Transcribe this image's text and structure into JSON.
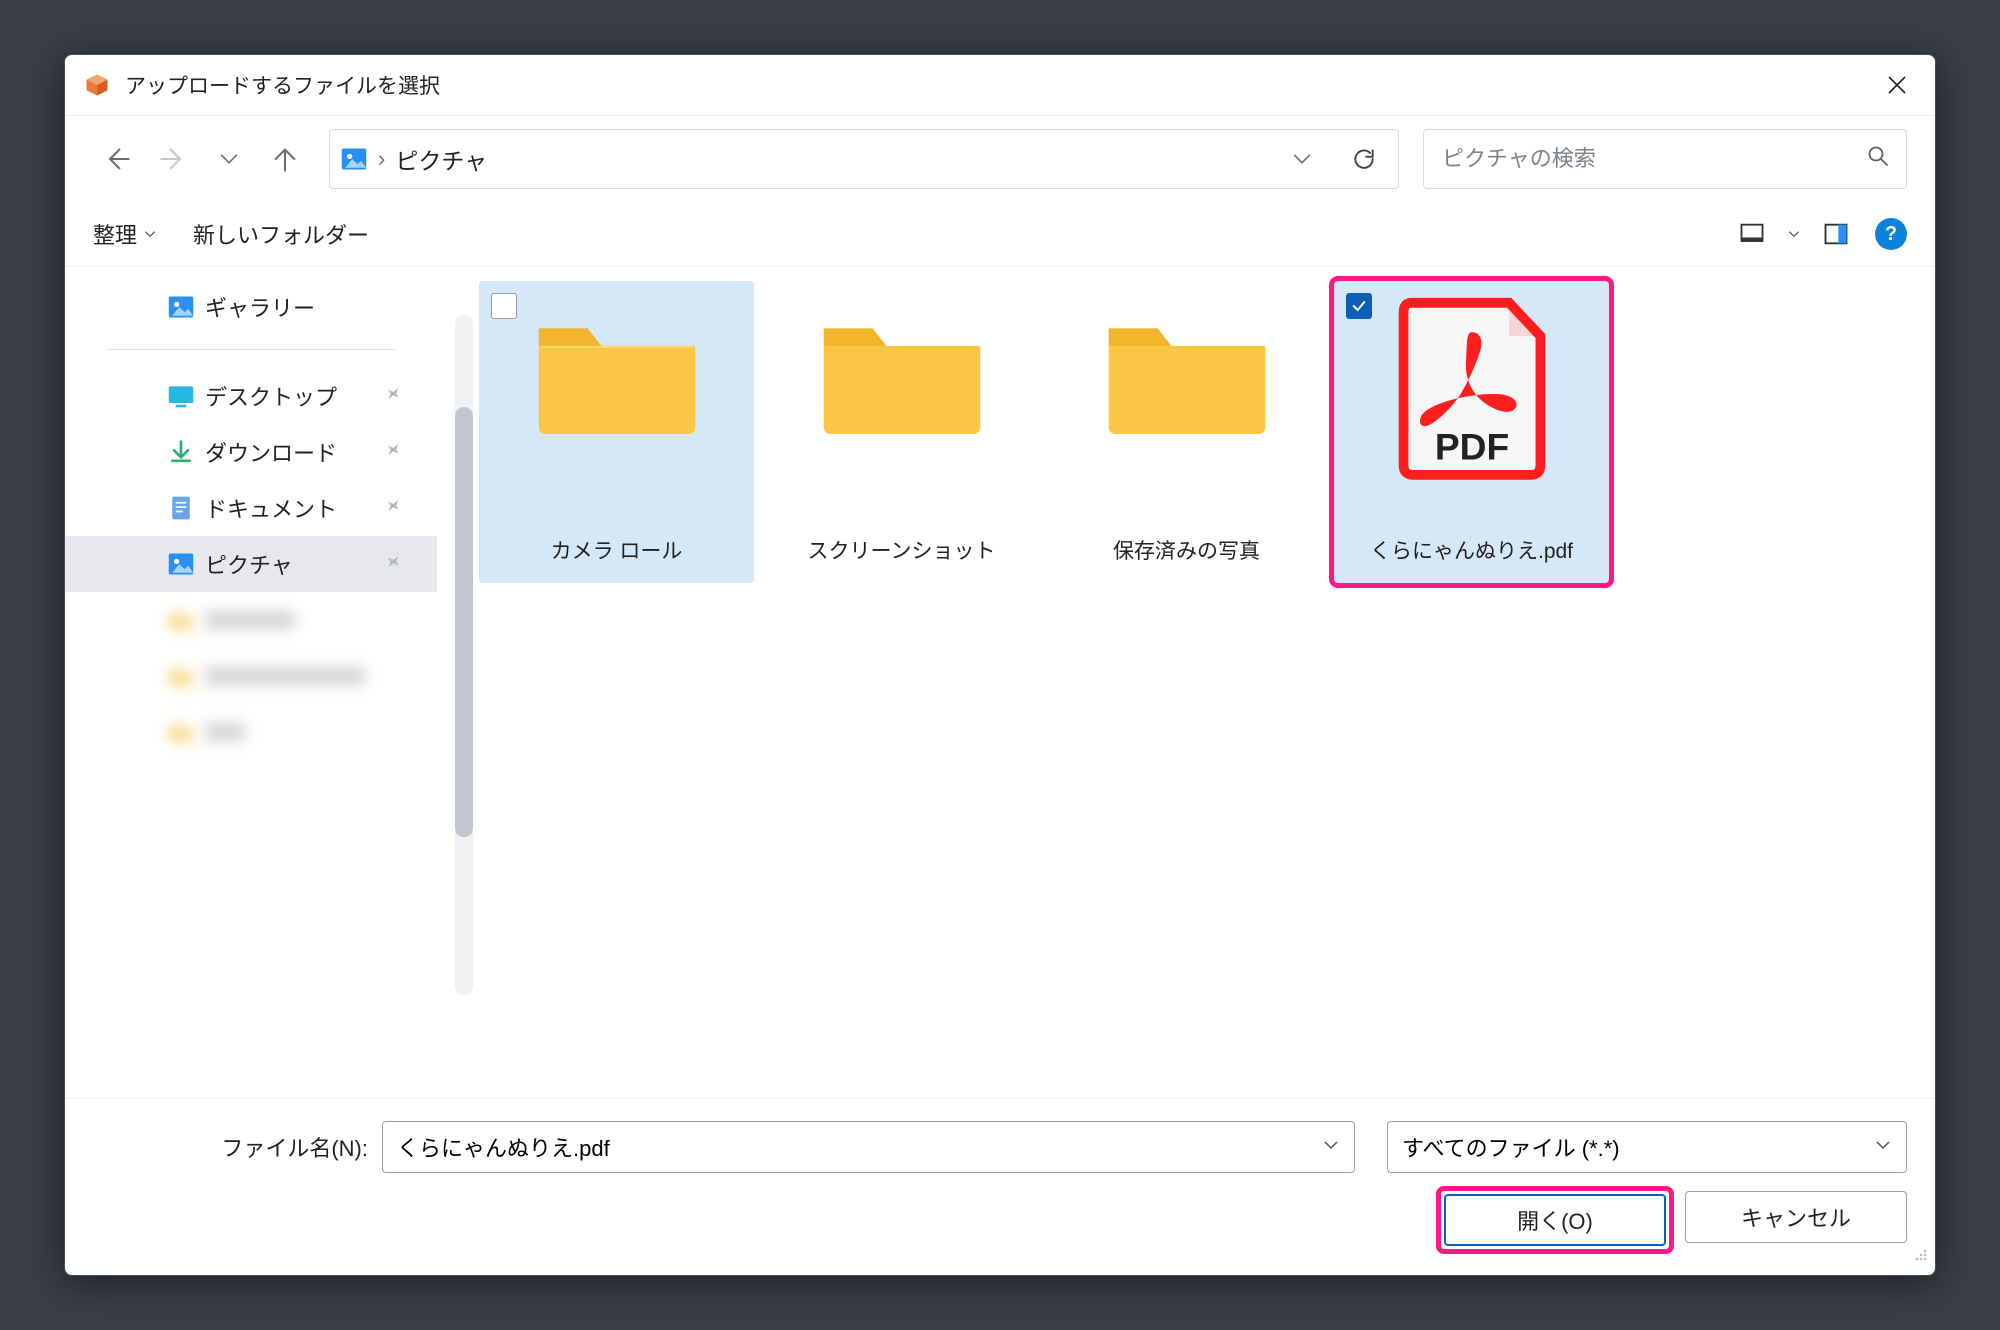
{
  "window": {
    "title": "アップロードするファイルを選択"
  },
  "path": {
    "current": "ピクチャ"
  },
  "search": {
    "placeholder": "ピクチャの検索"
  },
  "toolbar": {
    "organize": "整理",
    "new_folder": "新しいフォルダー"
  },
  "sidebar": {
    "gallery": "ギャラリー",
    "items": [
      {
        "label": "デスクトップ"
      },
      {
        "label": "ダウンロード"
      },
      {
        "label": "ドキュメント"
      },
      {
        "label": "ピクチャ"
      }
    ]
  },
  "files": [
    {
      "name": "カメラ ロール",
      "type": "folder",
      "selected": false,
      "hover": true
    },
    {
      "name": "スクリーンショット",
      "type": "folder",
      "selected": false,
      "hover": false
    },
    {
      "name": "保存済みの写真",
      "type": "folder",
      "selected": false,
      "hover": false
    },
    {
      "name": "くらにゃんぬりえ.pdf",
      "type": "pdf",
      "selected": true,
      "hover": false,
      "highlight": true
    }
  ],
  "footer": {
    "name_label": "ファイル名(N):",
    "name_value": "くらにゃんぬりえ.pdf",
    "type_value": "すべてのファイル (*.*)",
    "open": "開く(O)",
    "cancel": "キャンセル"
  },
  "pdf_badge": "PDF"
}
